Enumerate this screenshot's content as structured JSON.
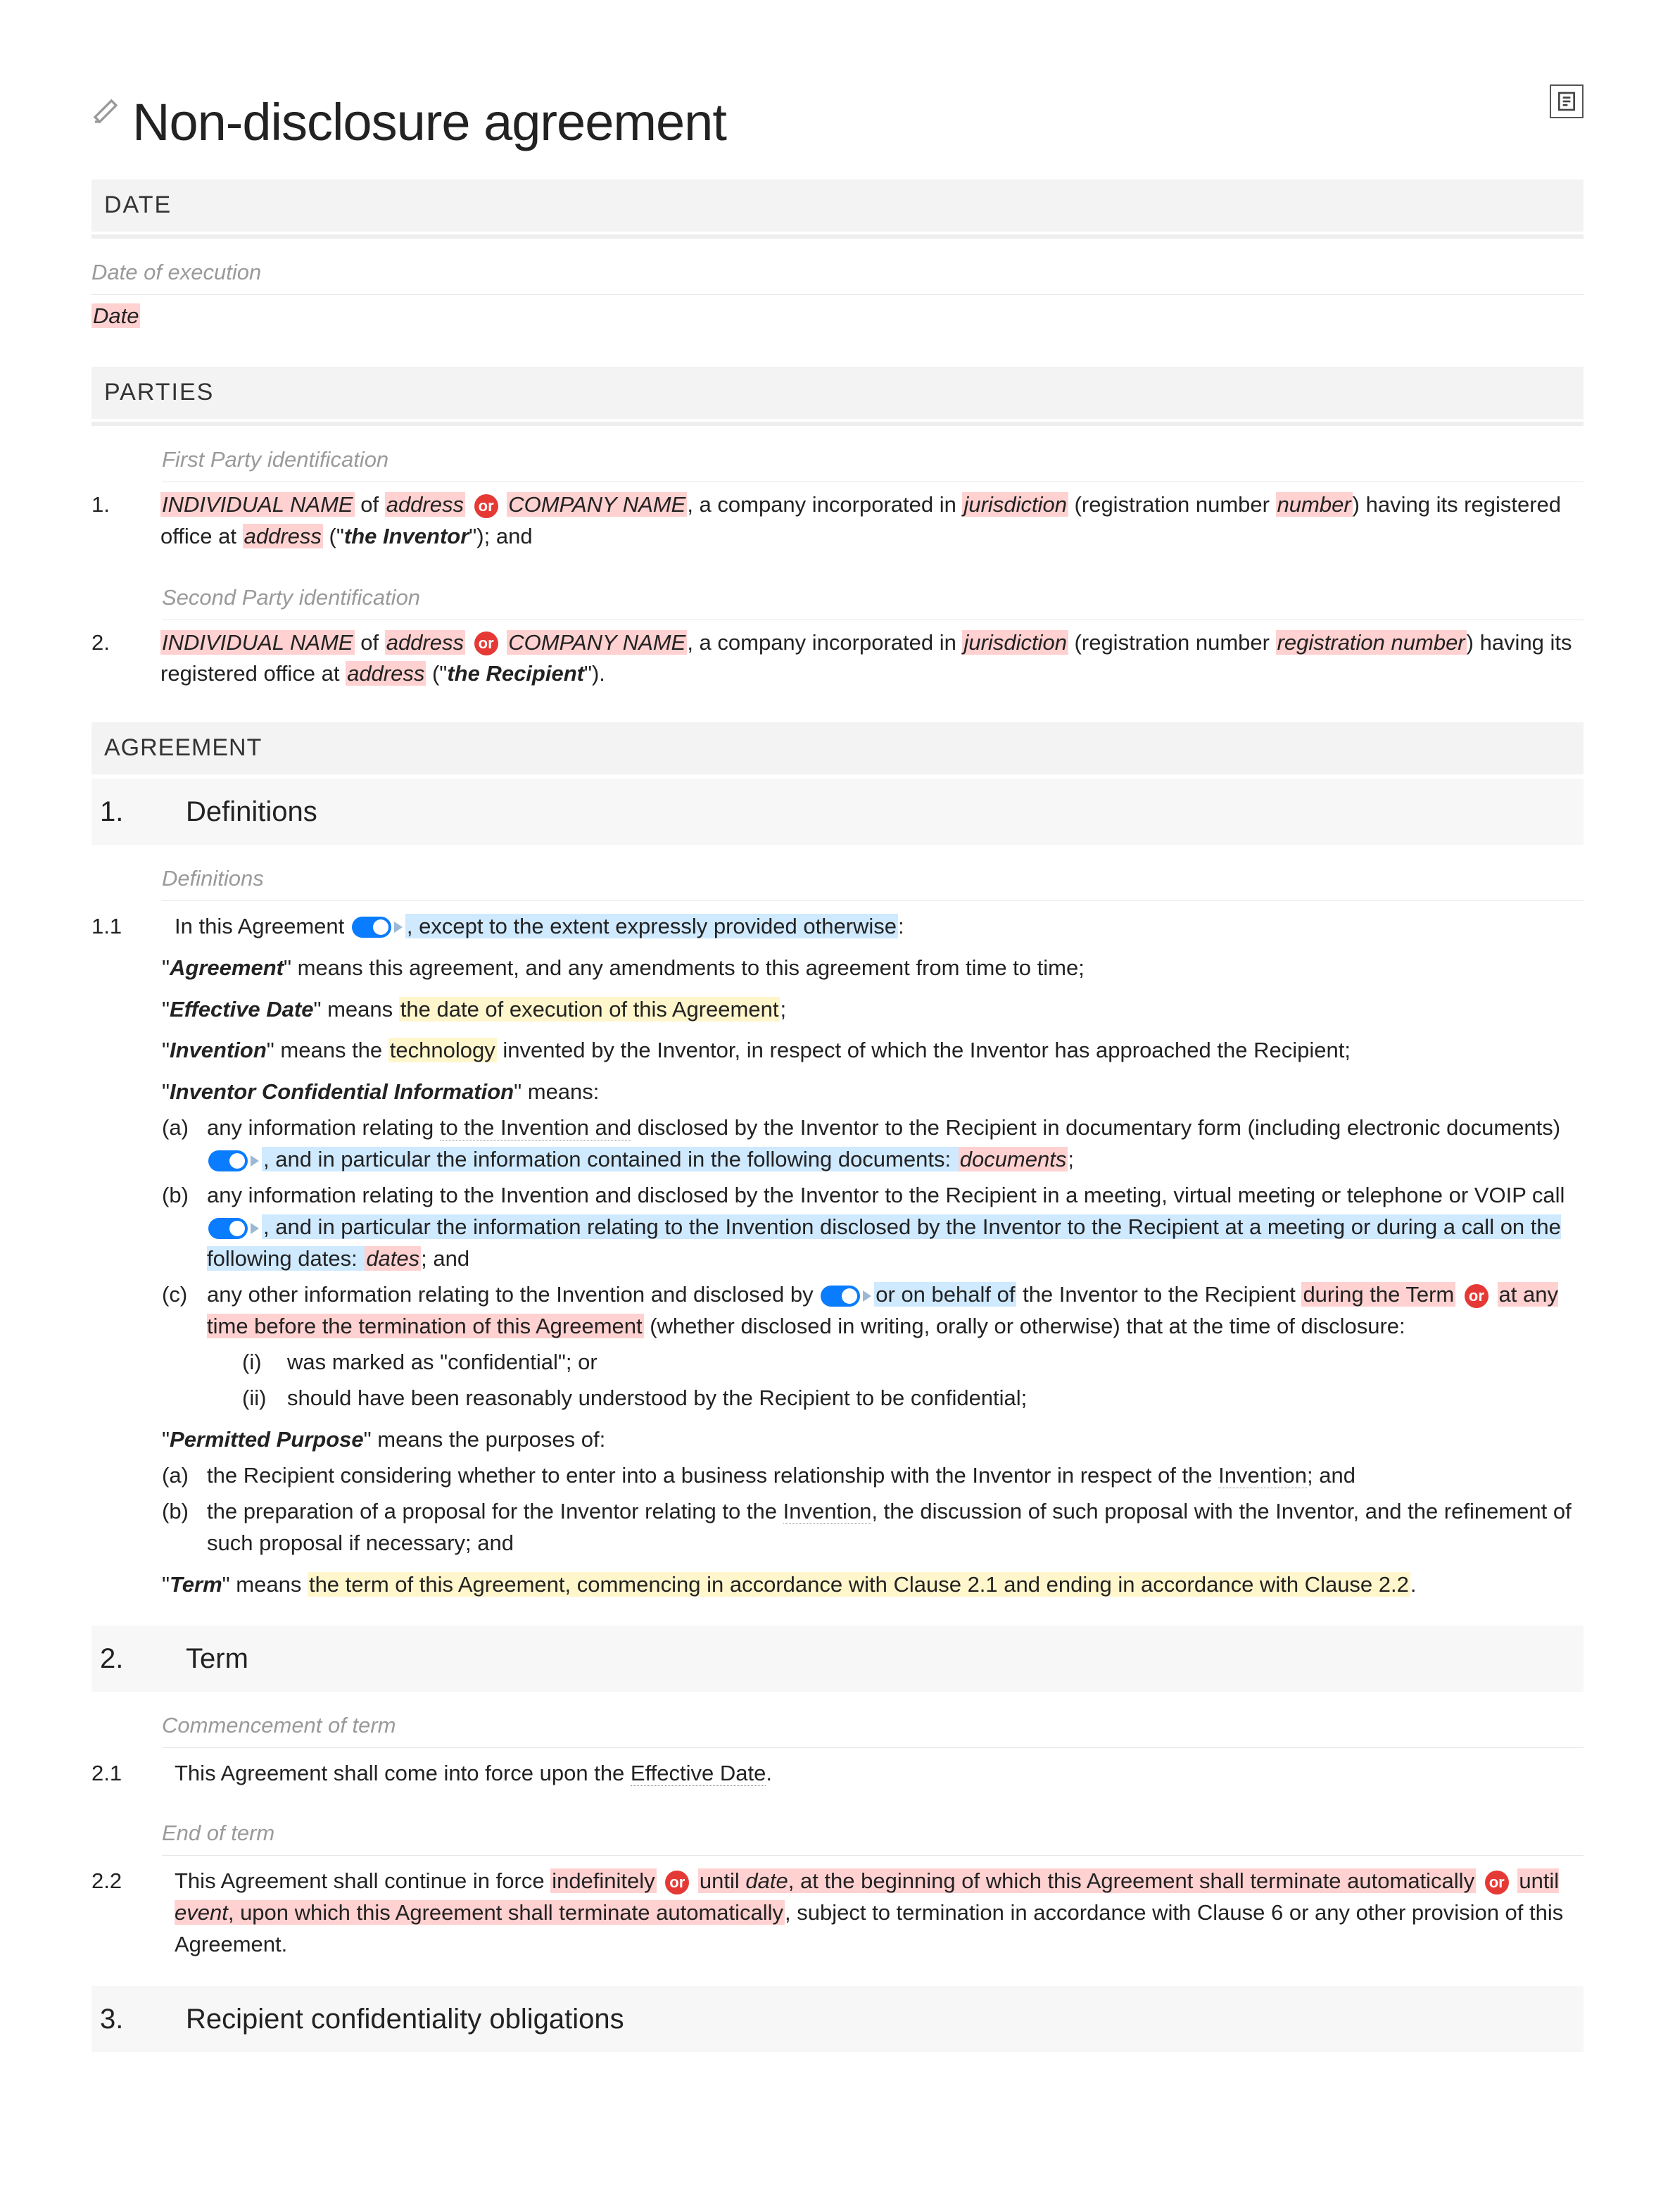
{
  "title": "Non-disclosure agreement",
  "sections": {
    "date_label": "DATE",
    "date_note": "Date of execution",
    "date_placeholder": "Date",
    "parties_label": "PARTIES",
    "party1_note": "First Party identification",
    "party2_note": "Second Party identification",
    "agreement_label": "AGREEMENT"
  },
  "party1": {
    "num": "1.",
    "indiv": "INDIVIDUAL NAME",
    "of": " of ",
    "addr": "address",
    "or": "or",
    "company": "COMPANY NAME",
    "txt1": ", a company incorporated in ",
    "juris": "jurisdiction",
    "txt2": " (registration number ",
    "number": "number",
    "txt3": ") having its registered office at ",
    "addr2": "address",
    "txt4": " (\"",
    "bold": "the Inventor",
    "txt5": "\"); and"
  },
  "party2": {
    "num": "2.",
    "indiv": "INDIVIDUAL NAME",
    "of": " of ",
    "addr": "address",
    "or": "or",
    "company": "COMPANY NAME",
    "txt1": ", a company incorporated in ",
    "juris": "jurisdiction",
    "txt2": " (registration number ",
    "number": "registration number",
    "txt3": ") having its registered office at ",
    "addr2": "address",
    "txt4": " (\"",
    "bold": "the Recipient",
    "txt5": "\")."
  },
  "sec1": {
    "num": "1.",
    "title": "Definitions",
    "note": "Definitions",
    "c11_num": "1.1",
    "c11_a": "In this Agreement ",
    "c11_b": ", except to the extent expressly provided otherwise",
    "c11_c": ":",
    "agreement_def": "\" means this agreement, and any amendments to this agreement from time to time;",
    "eff_a": "\" means ",
    "eff_b": "the date of execution of this Agreement",
    "eff_c": ";",
    "inv_a": "\" means the ",
    "inv_b": "technology",
    "inv_c": " invented by the Inventor, in respect of which the Inventor has approached the Recipient;",
    "ici_a": "\" means:",
    "ici_1a": "any information relating ",
    "ici_1b": "to the Invention and",
    "ici_1c": " disclosed by the Inventor to the Recipient in documentary form (including electronic documents) ",
    "ici_1d": ", and in particular the information contained in the following documents: ",
    "ici_1e": "documents",
    "ici_1f": ";",
    "ici_2a": "any information relating to the Invention and disclosed by the Inventor to the Recipient in a meeting, virtual meeting or telephone or VOIP call ",
    "ici_2b": ", and in particular the information relating to the Invention disclosed by the Inventor to the Recipient at a meeting or during a call on the following dates: ",
    "ici_2c": "dates",
    "ici_2d": "; and",
    "ici_3a": "any other information relating to the Invention and disclosed by ",
    "ici_3b": "or on behalf of",
    "ici_3c": " the Inventor to the Recipient ",
    "ici_3d": "during the Term",
    "ici_3or": "or",
    "ici_3e": "at any time before the termination of this Agreement",
    "ici_3f": " (whether disclosed in writing, orally or otherwise) that at the time of disclosure:",
    "ici_3i": "was marked as \"confidential\"; or",
    "ici_3ii": "should have been reasonably understood by the Recipient to be confidential;",
    "pp_a": "\" means the purposes of:",
    "pp_1": "the Recipient considering whether to enter into a business relationship with the Inventor in respect of the ",
    "pp_1b": "Invention",
    "pp_1c": "; and",
    "pp_2": "the preparation of a proposal for the Inventor relating to the ",
    "pp_2b": "Invention",
    "pp_2c": ", the discussion of such proposal with the Inventor, and the refinement of such proposal if necessary; and",
    "term_a": "\" means ",
    "term_b": "the term of this Agreement, commencing in accordance with Clause 2.1 and ending in accordance with Clause 2.2",
    "term_c": "."
  },
  "terms": {
    "agreement": "Agreement",
    "effective_date": "Effective Date",
    "invention": "Invention",
    "ici": "Inventor Confidential Information",
    "permitted_purpose": "Permitted Purpose",
    "term": "Term"
  },
  "sec2": {
    "num": "2.",
    "title": "Term",
    "note1": "Commencement of term",
    "c21_num": "2.1",
    "c21_a": "This Agreement shall come into force upon the ",
    "c21_b": "Effective Date",
    "c21_c": ".",
    "note2": "End of term",
    "c22_num": "2.2",
    "c22_a": "This Agreement shall continue in force ",
    "c22_b": "indefinitely",
    "c22_or1": "or",
    "c22_c": "until ",
    "c22_d": "date",
    "c22_e": ", at the beginning of which this Agreement shall terminate automatically",
    "c22_or2": "or",
    "c22_f": "until ",
    "c22_g": "event",
    "c22_h": ", upon which this Agreement shall terminate automatically",
    "c22_i": ", subject to termination in accordance with Clause 6 or any other provision of this Agreement."
  },
  "sec3": {
    "num": "3.",
    "title": "Recipient confidentiality obligations"
  },
  "labels": {
    "a": "(a)",
    "b": "(b)",
    "c": "(c)",
    "i": "(i)",
    "ii": "(ii)"
  }
}
